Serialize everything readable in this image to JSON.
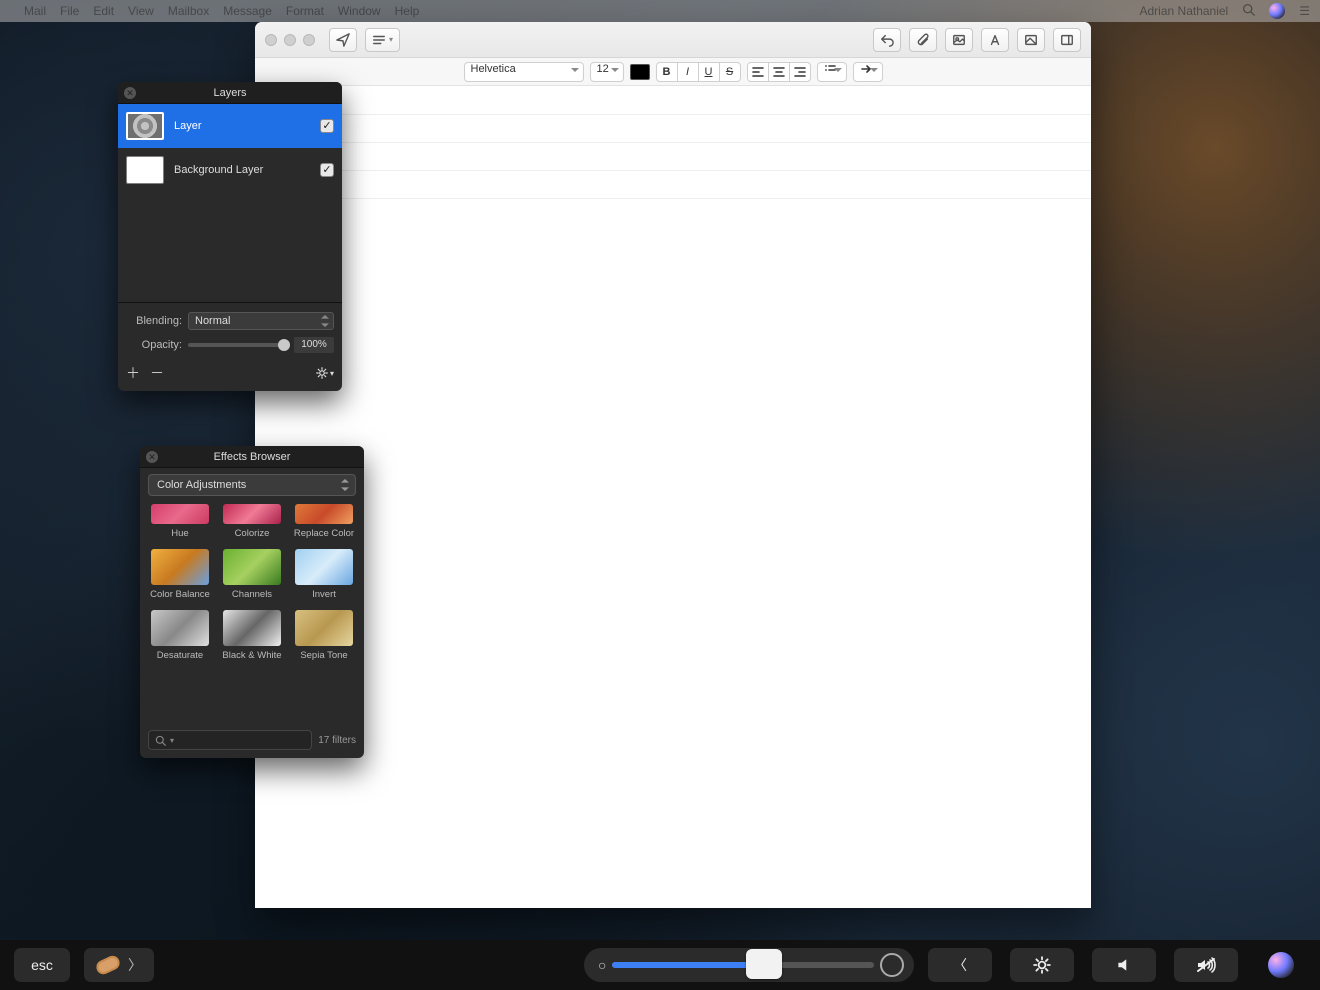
{
  "menubar": {
    "items": [
      "Mail",
      "File",
      "Edit",
      "View",
      "Mailbox",
      "Message",
      "Format",
      "Window",
      "Help"
    ],
    "right_user": "Adrian Nathaniel"
  },
  "doc": {
    "font_family": "Helvetica",
    "font_size": "12"
  },
  "layers": {
    "title": "Layers",
    "rows": [
      {
        "name": "Layer",
        "checked": true,
        "selected": true,
        "thumb": "spiral"
      },
      {
        "name": "Background Layer",
        "checked": true,
        "selected": false,
        "thumb": "white"
      }
    ],
    "blending_label": "Blending:",
    "blending_value": "Normal",
    "opacity_label": "Opacity:",
    "opacity_value": "100%"
  },
  "effects": {
    "title": "Effects Browser",
    "category": "Color Adjustments",
    "items": [
      {
        "label": "Hue",
        "cls": "fx-hue",
        "top": true
      },
      {
        "label": "Colorize",
        "cls": "fx-colorize",
        "top": true
      },
      {
        "label": "Replace Color",
        "cls": "fx-replace",
        "top": true
      },
      {
        "label": "Color Balance",
        "cls": "fx-balance"
      },
      {
        "label": "Channels",
        "cls": "fx-channels"
      },
      {
        "label": "Invert",
        "cls": "fx-invert"
      },
      {
        "label": "Desaturate",
        "cls": "fx-desat"
      },
      {
        "label": "Black & White",
        "cls": "fx-bw"
      },
      {
        "label": "Sepia Tone",
        "cls": "fx-sepia"
      }
    ],
    "filter_count": "17 filters"
  },
  "touchbar": {
    "esc": "esc"
  }
}
